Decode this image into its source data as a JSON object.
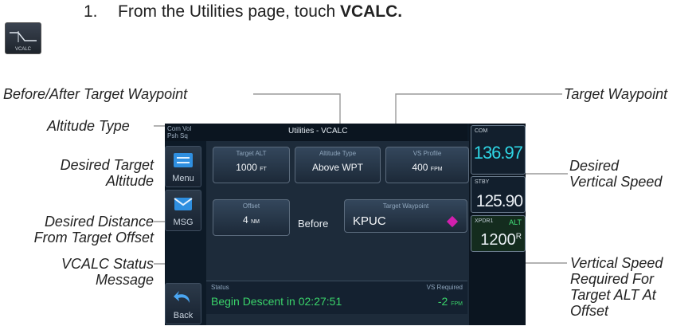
{
  "step": {
    "number": "1.",
    "text": "From the Utilities page, touch ",
    "emphasis": "VCALC."
  },
  "step_icon": {
    "label": "VCALC",
    "icon": "vcalc-profile-icon"
  },
  "callouts": {
    "before_after": "Before/After Target Waypoint",
    "altitude_type": "Altitude Type",
    "desired_alt_line1": "Desired Target",
    "desired_alt_line2": "Altitude",
    "desired_dist_line1": "Desired Distance",
    "desired_dist_line2": "From Target Offset",
    "status_line1": "VCALC Status",
    "status_line2": "Message",
    "target_wpt": "Target Waypoint",
    "desired_vs_line1": "Desired",
    "desired_vs_line2": "Vertical Speed",
    "vs_req_line1": "Vertical Speed",
    "vs_req_line2": "Required For",
    "vs_req_line3": "Target ALT At",
    "vs_req_line4": "Offset"
  },
  "screen": {
    "com_vol_line1": "Com Vol",
    "com_vol_line2": "Psh Sq",
    "title": "Utilities - VCALC",
    "left_keys": [
      {
        "label": "Menu",
        "icon": "menu-icon"
      },
      {
        "label": "MSG",
        "icon": "message-icon"
      },
      {
        "label": "Back",
        "icon": "back-arrow-icon"
      }
    ],
    "target_alt": {
      "label": "Target ALT",
      "value": "1000",
      "unit": "FT"
    },
    "altitude_type": {
      "label": "Altitude Type",
      "value": "Above WPT"
    },
    "vs_profile": {
      "label": "VS Profile",
      "value": "400",
      "unit": "FPM"
    },
    "offset": {
      "label": "Offset",
      "value": "4",
      "unit": "NM"
    },
    "before_after": "Before",
    "target_waypoint": {
      "label": "Target Waypoint",
      "value": "KPUC"
    },
    "status": {
      "label": "Status",
      "message": "Begin Descent in 02:27:51"
    },
    "vs_required": {
      "label": "VS Required",
      "value": "-2",
      "unit": "FPM"
    },
    "com": {
      "label": "COM",
      "freq": "136.97"
    },
    "stby": {
      "label": "STBY",
      "freq": "125.90"
    },
    "xpdr": {
      "label": "XPDR1",
      "mode": "ALT",
      "code": "1200",
      "suffix": "R"
    }
  },
  "colors": {
    "com_freq": "#2fd7e6",
    "status_msg": "#3ad36a",
    "waypoint_diamond": "#d21fae"
  }
}
